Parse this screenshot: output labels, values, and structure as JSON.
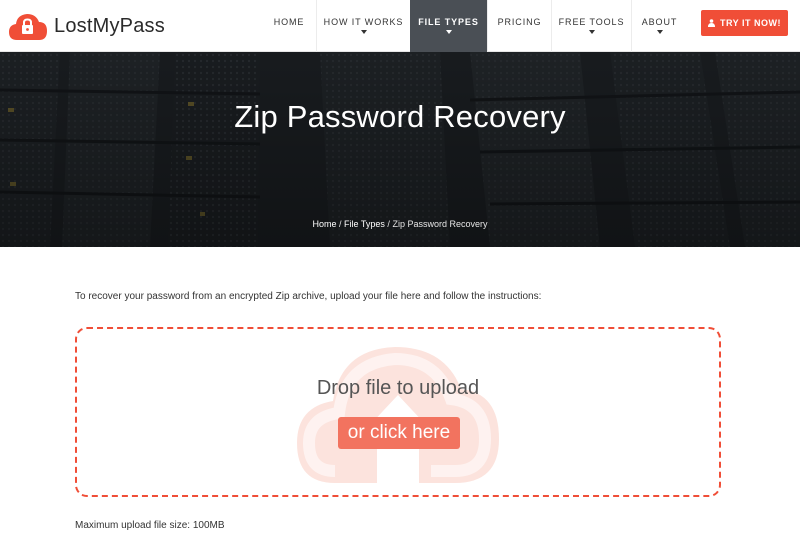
{
  "brand": {
    "name": "LostMyPass",
    "accent": "#f04e37"
  },
  "nav": {
    "items": [
      {
        "label": "HOME",
        "caret": false
      },
      {
        "label": "HOW IT WORKS",
        "caret": true
      },
      {
        "label": "FILE TYPES",
        "caret": true,
        "active": true
      },
      {
        "label": "PRICING",
        "caret": false
      },
      {
        "label": "FREE TOOLS",
        "caret": true
      },
      {
        "label": "ABOUT",
        "caret": true
      }
    ],
    "cta": {
      "label": "TRY IT NOW!",
      "icon": "user-icon"
    }
  },
  "hero": {
    "title": "Zip Password Recovery",
    "breadcrumb": {
      "home": "Home",
      "sep": "/",
      "section": "File Types",
      "current": "Zip Password Recovery"
    }
  },
  "content": {
    "intro": "To recover your password from an encrypted Zip archive, upload your file here and follow the instructions:",
    "dropzone": {
      "text": "Drop file to upload",
      "button": "or click here",
      "icon": "cloud-upload-icon"
    },
    "max_size": "Maximum upload file size: 100MB"
  }
}
